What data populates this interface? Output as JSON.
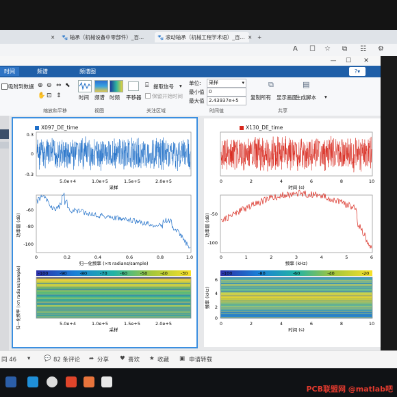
{
  "browser": {
    "tabs": [
      {
        "label": "轴承（机械设备中零部件）_百..."
      },
      {
        "label": "滚动轴承（机械工程学术语）_百..."
      }
    ]
  },
  "app": {
    "ribbon_tabs": [
      "时间",
      "频谱",
      "频谱图"
    ],
    "groups": {
      "zoom_pan": "缩放和平移",
      "view": "视图",
      "roi": "关注区域",
      "time_values": "时间值",
      "share": "共享"
    },
    "buttons": {
      "snap_to_data": "吸附到数据",
      "time": "时间",
      "spectrum": "频谱",
      "spectrogram": "时频",
      "panner": "平移器",
      "extract_signal": "提取信号",
      "keep_cursors": "保留开始时间",
      "copy_all": "复制所有",
      "display_grid": "显示画面",
      "gen_script": "生成脚本"
    },
    "time_values": {
      "units_label": "单位:",
      "units_value": "采样",
      "min_label": "最小值",
      "min_value": "0",
      "max_label": "最大值",
      "max_value": "2.43937e+5"
    }
  },
  "left_panel": {
    "signal_name": "X097_DE_time",
    "time_xlabel": "采样",
    "time_xticks": [
      "5.0e+4",
      "1.0e+5",
      "1.5e+5",
      "2.0e+5"
    ],
    "time_yticks": [
      "0.3",
      "0",
      "-0.3"
    ],
    "spec_ylabel": "功率谱 (dB)",
    "spec_xlabel": "归一化频率 (×π radians/sample)",
    "spec_xticks": [
      "0",
      "0.2",
      "0.4",
      "0.6",
      "0.8",
      "1.0"
    ],
    "spec_yticks": [
      "-60",
      "-80",
      "-100"
    ],
    "tf_ylabel": "归一化频率 (×π radians/sample)",
    "tf_xlabel": "采样",
    "tf_xticks": [
      "5.0e+4",
      "1.0e+5",
      "1.5e+5",
      "2.0e+5"
    ],
    "tf_cbar": [
      "-100",
      "-90",
      "-80",
      "-70",
      "-60",
      "-50",
      "-40",
      "-30"
    ]
  },
  "right_panel": {
    "signal_name": "X130_DE_time",
    "time_xlabel": "时间 (s)",
    "time_xticks": [
      "0",
      "2",
      "4",
      "6",
      "8",
      "10"
    ],
    "spec_ylabel": "功率谱 (dB)",
    "spec_xlabel": "频率 (kHz)",
    "spec_xticks": [
      "0",
      "1",
      "2",
      "3",
      "4",
      "5",
      "6"
    ],
    "spec_yticks": [
      "-50",
      "-100"
    ],
    "tf_ylabel": "频率 (kHz)",
    "tf_xlabel": "时间 (s)",
    "tf_xticks": [
      "0",
      "2",
      "4",
      "6",
      "8",
      "10"
    ],
    "tf_yticks": [
      "6",
      "4",
      "2",
      "0"
    ],
    "tf_cbar": [
      "-100",
      "-80",
      "-60",
      "-40",
      "-20"
    ]
  },
  "bottom": {
    "likes": "同 46",
    "comments": "82 条评论",
    "share": "分享",
    "fav": "喜欢",
    "collect": "收藏",
    "reprint": "申请转载"
  },
  "watermark": "PCB联盟网 @matlab吧",
  "colors": {
    "blue": "#1f6fc8",
    "red": "#d8271c",
    "ribbon": "#1f5fa8"
  }
}
